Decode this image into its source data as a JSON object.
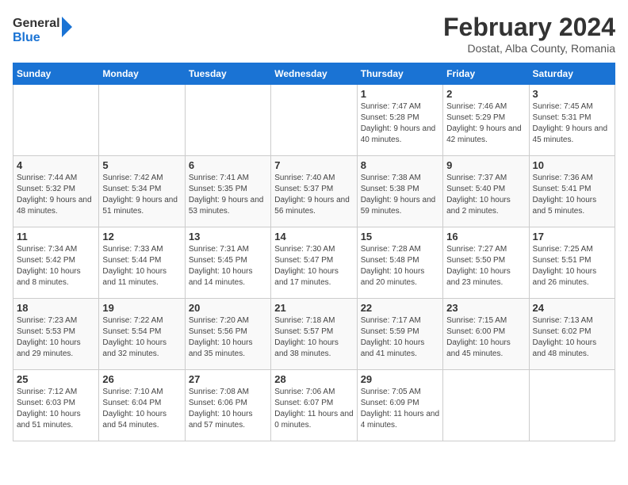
{
  "header": {
    "logo_line1": "General",
    "logo_line2": "Blue",
    "title": "February 2024",
    "subtitle": "Dostat, Alba County, Romania"
  },
  "calendar": {
    "days_of_week": [
      "Sunday",
      "Monday",
      "Tuesday",
      "Wednesday",
      "Thursday",
      "Friday",
      "Saturday"
    ],
    "weeks": [
      [
        {
          "num": "",
          "info": ""
        },
        {
          "num": "",
          "info": ""
        },
        {
          "num": "",
          "info": ""
        },
        {
          "num": "",
          "info": ""
        },
        {
          "num": "1",
          "info": "Sunrise: 7:47 AM\nSunset: 5:28 PM\nDaylight: 9 hours and 40 minutes."
        },
        {
          "num": "2",
          "info": "Sunrise: 7:46 AM\nSunset: 5:29 PM\nDaylight: 9 hours and 42 minutes."
        },
        {
          "num": "3",
          "info": "Sunrise: 7:45 AM\nSunset: 5:31 PM\nDaylight: 9 hours and 45 minutes."
        }
      ],
      [
        {
          "num": "4",
          "info": "Sunrise: 7:44 AM\nSunset: 5:32 PM\nDaylight: 9 hours and 48 minutes."
        },
        {
          "num": "5",
          "info": "Sunrise: 7:42 AM\nSunset: 5:34 PM\nDaylight: 9 hours and 51 minutes."
        },
        {
          "num": "6",
          "info": "Sunrise: 7:41 AM\nSunset: 5:35 PM\nDaylight: 9 hours and 53 minutes."
        },
        {
          "num": "7",
          "info": "Sunrise: 7:40 AM\nSunset: 5:37 PM\nDaylight: 9 hours and 56 minutes."
        },
        {
          "num": "8",
          "info": "Sunrise: 7:38 AM\nSunset: 5:38 PM\nDaylight: 9 hours and 59 minutes."
        },
        {
          "num": "9",
          "info": "Sunrise: 7:37 AM\nSunset: 5:40 PM\nDaylight: 10 hours and 2 minutes."
        },
        {
          "num": "10",
          "info": "Sunrise: 7:36 AM\nSunset: 5:41 PM\nDaylight: 10 hours and 5 minutes."
        }
      ],
      [
        {
          "num": "11",
          "info": "Sunrise: 7:34 AM\nSunset: 5:42 PM\nDaylight: 10 hours and 8 minutes."
        },
        {
          "num": "12",
          "info": "Sunrise: 7:33 AM\nSunset: 5:44 PM\nDaylight: 10 hours and 11 minutes."
        },
        {
          "num": "13",
          "info": "Sunrise: 7:31 AM\nSunset: 5:45 PM\nDaylight: 10 hours and 14 minutes."
        },
        {
          "num": "14",
          "info": "Sunrise: 7:30 AM\nSunset: 5:47 PM\nDaylight: 10 hours and 17 minutes."
        },
        {
          "num": "15",
          "info": "Sunrise: 7:28 AM\nSunset: 5:48 PM\nDaylight: 10 hours and 20 minutes."
        },
        {
          "num": "16",
          "info": "Sunrise: 7:27 AM\nSunset: 5:50 PM\nDaylight: 10 hours and 23 minutes."
        },
        {
          "num": "17",
          "info": "Sunrise: 7:25 AM\nSunset: 5:51 PM\nDaylight: 10 hours and 26 minutes."
        }
      ],
      [
        {
          "num": "18",
          "info": "Sunrise: 7:23 AM\nSunset: 5:53 PM\nDaylight: 10 hours and 29 minutes."
        },
        {
          "num": "19",
          "info": "Sunrise: 7:22 AM\nSunset: 5:54 PM\nDaylight: 10 hours and 32 minutes."
        },
        {
          "num": "20",
          "info": "Sunrise: 7:20 AM\nSunset: 5:56 PM\nDaylight: 10 hours and 35 minutes."
        },
        {
          "num": "21",
          "info": "Sunrise: 7:18 AM\nSunset: 5:57 PM\nDaylight: 10 hours and 38 minutes."
        },
        {
          "num": "22",
          "info": "Sunrise: 7:17 AM\nSunset: 5:59 PM\nDaylight: 10 hours and 41 minutes."
        },
        {
          "num": "23",
          "info": "Sunrise: 7:15 AM\nSunset: 6:00 PM\nDaylight: 10 hours and 45 minutes."
        },
        {
          "num": "24",
          "info": "Sunrise: 7:13 AM\nSunset: 6:02 PM\nDaylight: 10 hours and 48 minutes."
        }
      ],
      [
        {
          "num": "25",
          "info": "Sunrise: 7:12 AM\nSunset: 6:03 PM\nDaylight: 10 hours and 51 minutes."
        },
        {
          "num": "26",
          "info": "Sunrise: 7:10 AM\nSunset: 6:04 PM\nDaylight: 10 hours and 54 minutes."
        },
        {
          "num": "27",
          "info": "Sunrise: 7:08 AM\nSunset: 6:06 PM\nDaylight: 10 hours and 57 minutes."
        },
        {
          "num": "28",
          "info": "Sunrise: 7:06 AM\nSunset: 6:07 PM\nDaylight: 11 hours and 0 minutes."
        },
        {
          "num": "29",
          "info": "Sunrise: 7:05 AM\nSunset: 6:09 PM\nDaylight: 11 hours and 4 minutes."
        },
        {
          "num": "",
          "info": ""
        },
        {
          "num": "",
          "info": ""
        }
      ]
    ]
  }
}
